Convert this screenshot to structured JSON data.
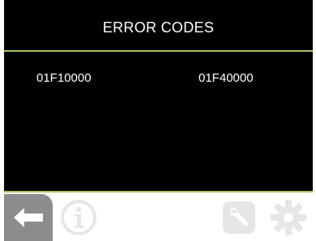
{
  "header": {
    "title": "ERROR CODES"
  },
  "error_codes": [
    "01F10000",
    "01F40000"
  ],
  "footer": {
    "icons": [
      "back-arrow-icon",
      "info-icon",
      "wrench-icon",
      "gear-icon"
    ]
  },
  "colors": {
    "background": "#000000",
    "accent_rule": "#a6c94a",
    "text": "#ffffff",
    "back_button": "#8c8c8c",
    "disabled_icon": "#e6e6e6"
  }
}
